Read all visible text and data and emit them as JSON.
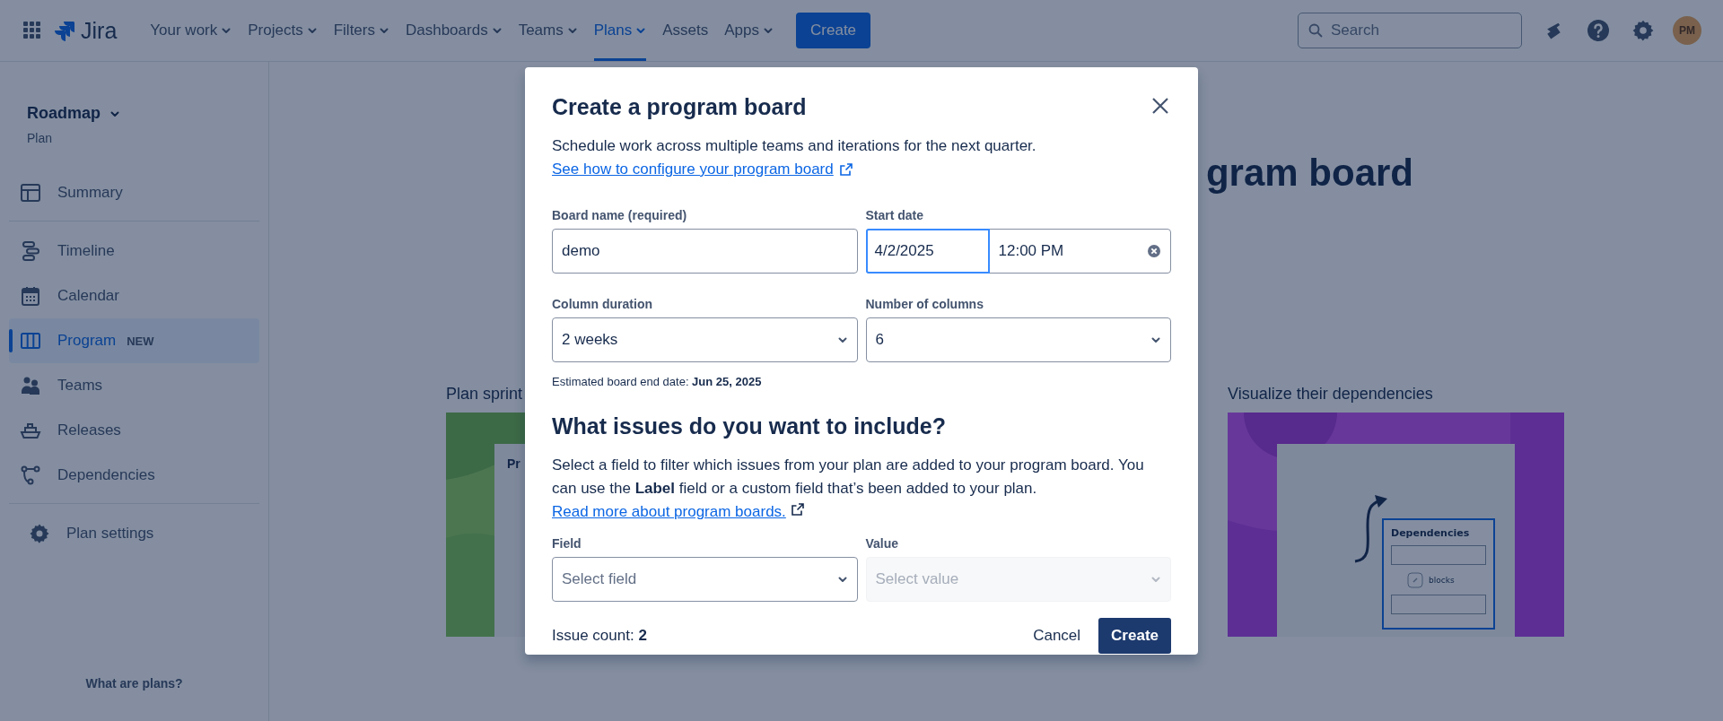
{
  "topbar": {
    "product": "Jira",
    "nav": [
      {
        "label": "Your work",
        "dropdown": true,
        "selected": false
      },
      {
        "label": "Projects",
        "dropdown": true,
        "selected": false
      },
      {
        "label": "Filters",
        "dropdown": true,
        "selected": false
      },
      {
        "label": "Dashboards",
        "dropdown": true,
        "selected": false
      },
      {
        "label": "Teams",
        "dropdown": true,
        "selected": false
      },
      {
        "label": "Plans",
        "dropdown": true,
        "selected": true
      },
      {
        "label": "Assets",
        "dropdown": false,
        "selected": false
      },
      {
        "label": "Apps",
        "dropdown": true,
        "selected": false
      }
    ],
    "create_button": "Create",
    "search": {
      "placeholder": "Search"
    },
    "avatar": "PM"
  },
  "sidebar": {
    "title": "Roadmap",
    "subtitle": "Plan",
    "groups": [
      [
        {
          "label": "Summary",
          "kind": "summary",
          "selected": false
        }
      ],
      [
        {
          "label": "Timeline",
          "kind": "timeline",
          "selected": false
        },
        {
          "label": "Calendar",
          "kind": "calendar",
          "selected": false
        },
        {
          "label": "Program",
          "kind": "program",
          "selected": true,
          "badge": "NEW"
        },
        {
          "label": "Teams",
          "kind": "teams",
          "selected": false
        },
        {
          "label": "Releases",
          "kind": "releases",
          "selected": false
        },
        {
          "label": "Dependencies",
          "kind": "dependencies",
          "selected": false
        }
      ]
    ],
    "settings": "Plan settings",
    "footer_link": "What are plans?"
  },
  "background": {
    "heading": "gram board",
    "features": [
      {
        "title": "Plan sprint",
        "kind": "sprints",
        "panel_title": "Pr"
      },
      {
        "title": "Visualize their dependencies",
        "kind": "dependencies",
        "card_title": "Dependencies",
        "link_label": "blocks"
      }
    ]
  },
  "dialog": {
    "title": "Create a program board",
    "description": "Schedule work across multiple teams and iterations for the next quarter.",
    "help_link": "See how to configure your program board",
    "board_name": {
      "label": "Board name (required)",
      "value": "demo"
    },
    "start_date": {
      "label": "Start date",
      "date": "4/2/2025",
      "time": "12:00 PM",
      "focused": true
    },
    "column_duration": {
      "label": "Column duration",
      "value": "2 weeks"
    },
    "number_of_columns": {
      "label": "Number of columns",
      "value": "6"
    },
    "estimate": "Estimated board end date: **Jun 25, 2025**",
    "section_title": "What issues do you want to include?",
    "section_text": "Select a field to filter which issues from your plan are added to your program board. You can use the **Label** field or a custom field that’s been added to your plan.",
    "section_link": "Read more about program boards.",
    "field": {
      "label": "Field",
      "placeholder": "Select field",
      "disabled": false
    },
    "value": {
      "label": "Value",
      "placeholder": "Select value",
      "disabled": true
    },
    "issue_count": "Issue count: **2**",
    "cancel_button": "Cancel",
    "create_button": "Create"
  }
}
